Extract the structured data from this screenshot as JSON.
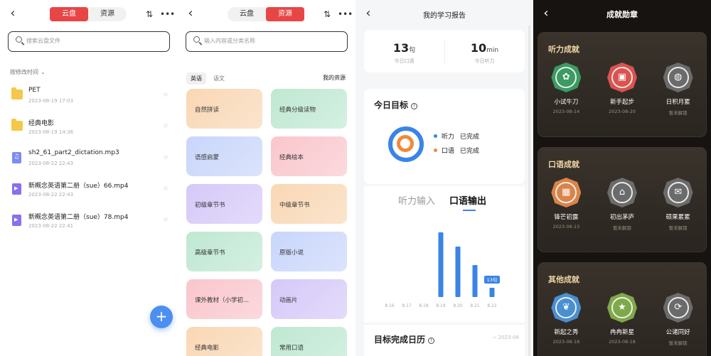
{
  "panel1": {
    "tabs": [
      "云盘",
      "资源"
    ],
    "active_tab": "云盘",
    "search_placeholder": "搜索云盘文件",
    "sort_label": "按修改时间",
    "files": [
      {
        "type": "folder",
        "name": "PET",
        "date": "2023-08-19 17:03"
      },
      {
        "type": "folder",
        "name": "经典电影",
        "date": "2023-08-19 14:36"
      },
      {
        "type": "audio",
        "name": "sh2_61_part2_dictation.mp3",
        "date": "2023-08-22 22:43"
      },
      {
        "type": "video",
        "name": "新概念英语第二册（sue）66.mp4",
        "date": "2023-08-22 22:43"
      },
      {
        "type": "video",
        "name": "新概念英语第二册（sue）78.mp4",
        "date": "2023-08-22 22:41"
      }
    ],
    "fab": "+"
  },
  "panel2": {
    "tabs": [
      "云盘",
      "资源"
    ],
    "active_tab": "资源",
    "search_placeholder": "输入内容或分类名称",
    "subtabs": [
      "英语",
      "语文"
    ],
    "active_subtab": "英语",
    "my_resources": "我的资源",
    "cards": [
      {
        "label": "自然拼读",
        "color": "#f9d7b4"
      },
      {
        "label": "经典分级读物",
        "color": "#bfe8d2"
      },
      {
        "label": "语感启蒙",
        "color": "#c9d6fb"
      },
      {
        "label": "经典绘本",
        "color": "#f9c6cc"
      },
      {
        "label": "初级章节书",
        "color": "#d5c9f8"
      },
      {
        "label": "中级章节书",
        "color": "#f9d7b4"
      },
      {
        "label": "高级章节书",
        "color": "#bfe8d2"
      },
      {
        "label": "原版小说",
        "color": "#c9d6fb"
      },
      {
        "label": "课外教材（小学初...",
        "color": "#f9c6cc"
      },
      {
        "label": "动画片",
        "color": "#d5c9f8"
      },
      {
        "label": "经典电影",
        "color": "#f9d7b4"
      },
      {
        "label": "常用口语",
        "color": "#bfe8d2"
      }
    ]
  },
  "panel3": {
    "title": "我的学习报告",
    "stats": [
      {
        "value": "13",
        "unit": "句",
        "label": "今日口语"
      },
      {
        "value": "10",
        "unit": "min",
        "label": "今日听力"
      }
    ],
    "goal_title": "今日目标",
    "goals": [
      {
        "name": "听力",
        "status": "已完成",
        "color": "#3a84e6"
      },
      {
        "name": "口语",
        "status": "已完成",
        "color": "#f08a3a"
      }
    ],
    "chart_tabs": [
      "听力输入",
      "口语输出"
    ],
    "active_chart_tab": "口语输出",
    "calendar_title": "目标完成日历",
    "calendar_date": "2023-08"
  },
  "chart_data": {
    "type": "bar",
    "categories": [
      "8.16",
      "8.17",
      "8.18",
      "8.19",
      "8.20",
      "8.21",
      "8.22"
    ],
    "values": [
      0,
      0,
      0,
      91,
      71,
      45,
      13
    ],
    "highlight_label": "13句",
    "title": "",
    "xlabel": "",
    "ylabel": "",
    "color": "#3a84e6"
  },
  "panel4": {
    "title": "成就勋章",
    "sections": [
      {
        "title": "听力成就",
        "badges": [
          {
            "name": "小试牛刀",
            "date": "2023-08-14",
            "color": "#3c9a63",
            "icon": "plant-icon",
            "glyph": "✿"
          },
          {
            "name": "新手起步",
            "date": "2023-08-20",
            "color": "#d9534f",
            "icon": "radio-icon",
            "glyph": "▣"
          },
          {
            "name": "日积月累",
            "date": "暂未解锁",
            "color": "#6b6b6b",
            "icon": "ball-icon",
            "glyph": "◍"
          }
        ]
      },
      {
        "title": "口语成就",
        "badges": [
          {
            "name": "锋芒初露",
            "date": "2023-08-13",
            "color": "#d9844a",
            "icon": "box-icon",
            "glyph": "▦"
          },
          {
            "name": "初出茅庐",
            "date": "暂未解锁",
            "color": "#6b6b6b",
            "icon": "house-icon",
            "glyph": "⌂"
          },
          {
            "name": "硕果累累",
            "date": "暂未解锁",
            "color": "#6b6b6b",
            "icon": "chat-icon",
            "glyph": "✉"
          }
        ]
      },
      {
        "title": "其他成就",
        "badges": [
          {
            "name": "新起之秀",
            "date": "2023-08-18",
            "color": "#4a8fd0",
            "icon": "bird-icon",
            "glyph": "❦"
          },
          {
            "name": "冉冉新星",
            "date": "2023-08-18",
            "color": "#7fa84a",
            "icon": "star-icon",
            "glyph": "★"
          },
          {
            "name": "公诸同好",
            "date": "暂未解锁",
            "color": "#6b6b6b",
            "icon": "share-icon",
            "glyph": "⟳"
          }
        ]
      }
    ]
  }
}
